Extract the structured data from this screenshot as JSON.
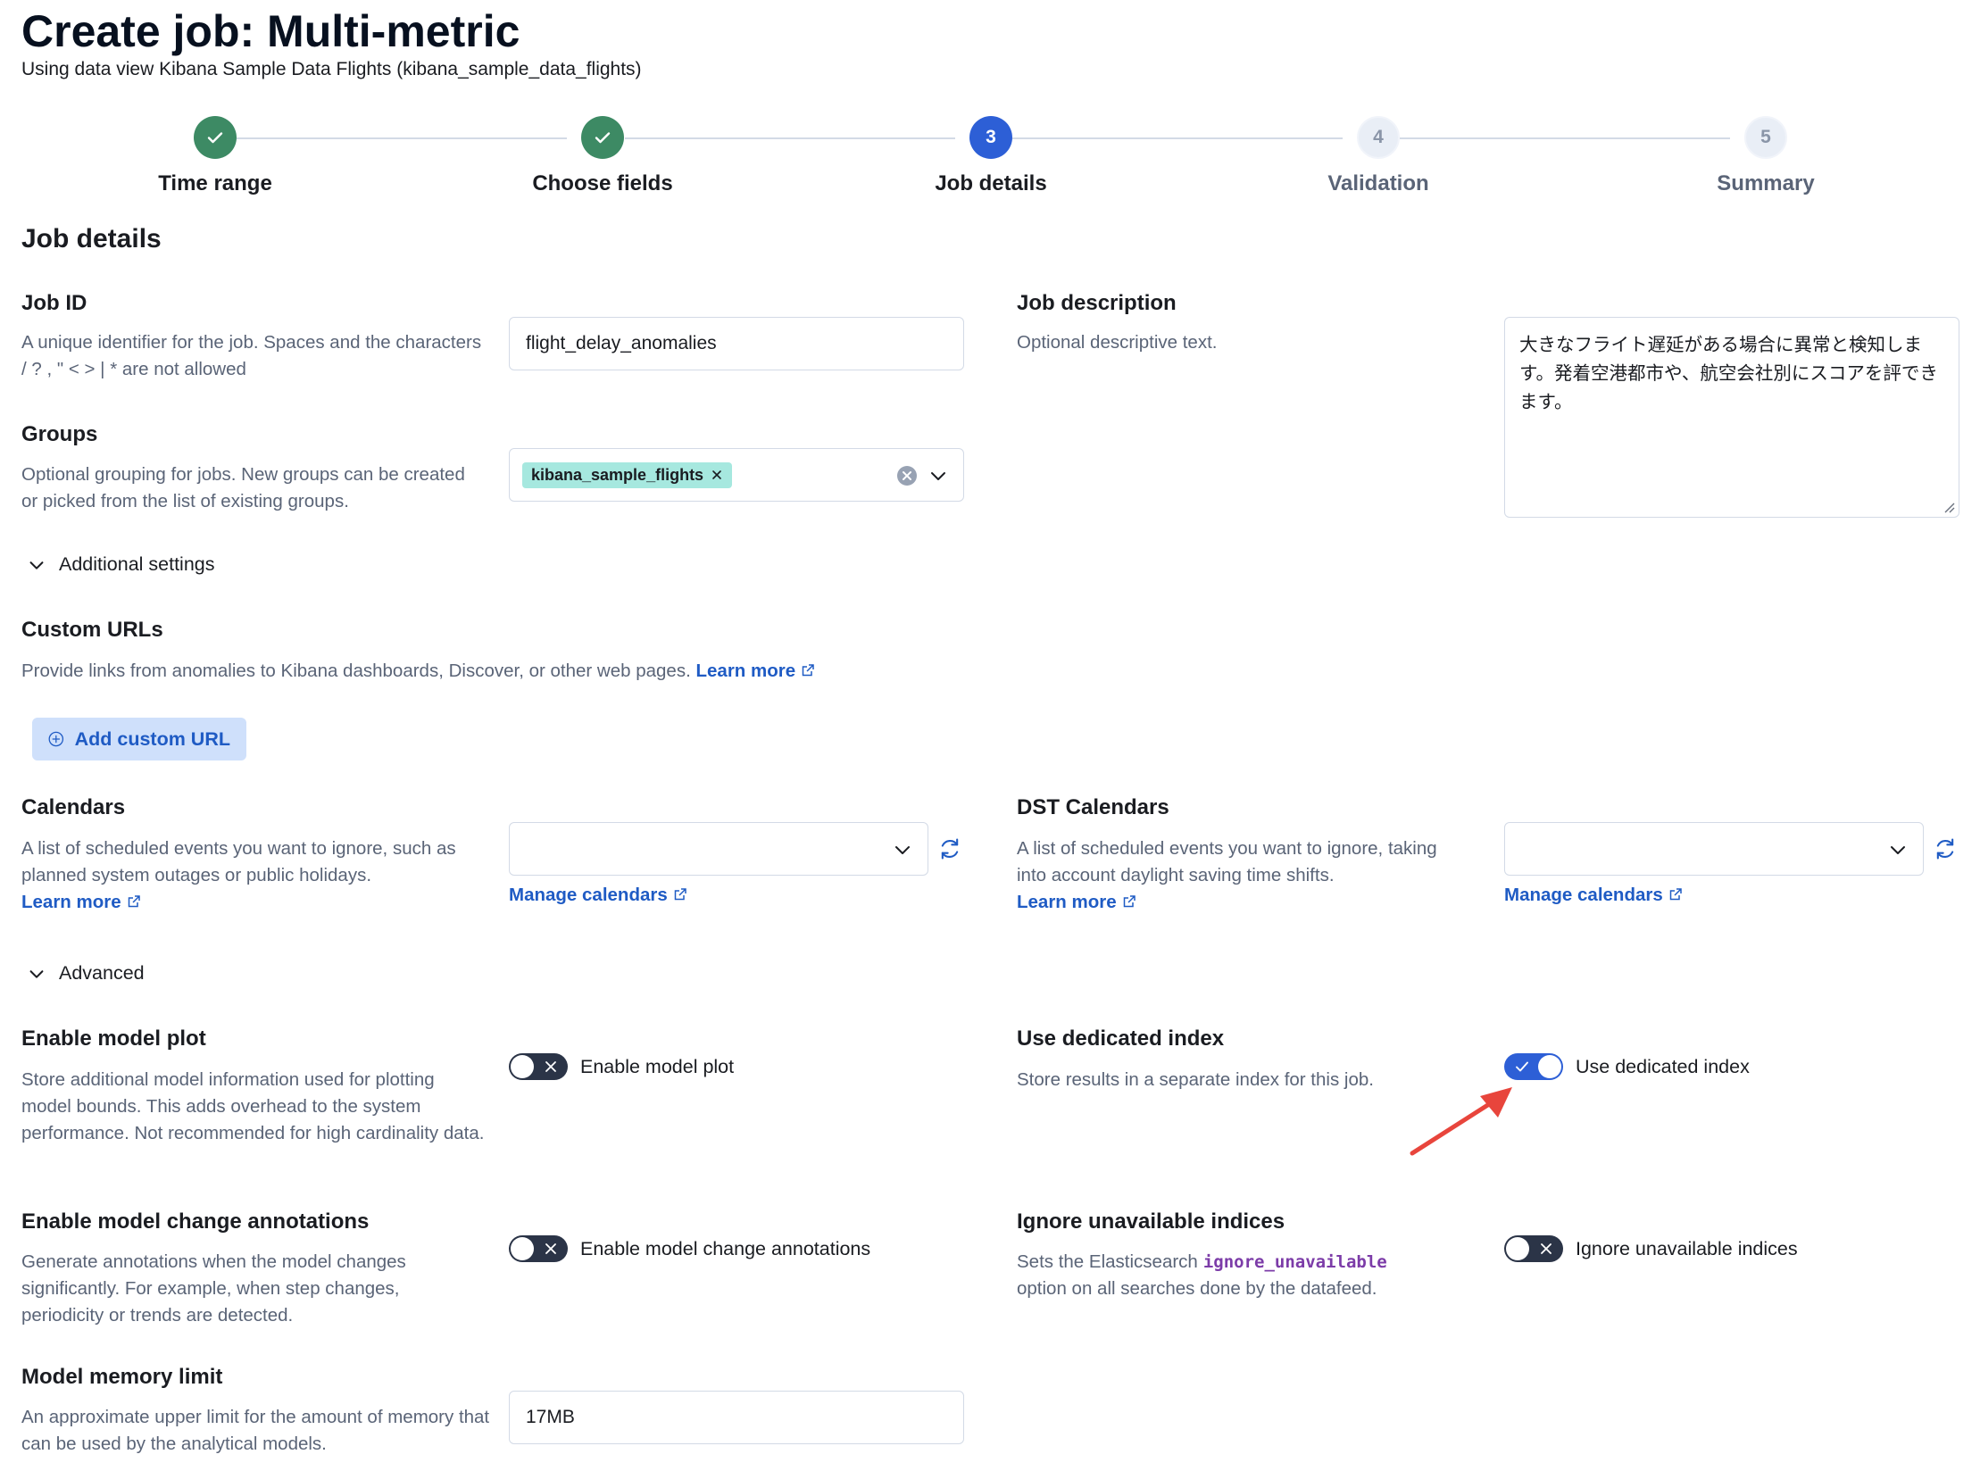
{
  "header": {
    "title": "Create job: Multi-metric",
    "subtitle": "Using data view Kibana Sample Data Flights (kibana_sample_data_flights)"
  },
  "steps": [
    {
      "label": "Time range",
      "number": "1",
      "status": "complete"
    },
    {
      "label": "Choose fields",
      "number": "2",
      "status": "complete"
    },
    {
      "label": "Job details",
      "number": "3",
      "status": "current"
    },
    {
      "label": "Validation",
      "number": "4",
      "status": "incomplete"
    },
    {
      "label": "Summary",
      "number": "5",
      "status": "incomplete"
    }
  ],
  "section_title": "Job details",
  "job_id": {
    "title": "Job ID",
    "help": "A unique identifier for the job. Spaces and the characters / ? , \" < > | * are not allowed",
    "value": "flight_delay_anomalies"
  },
  "job_description": {
    "title": "Job description",
    "help": "Optional descriptive text.",
    "value": "大きなフライト遅延がある場合に異常と検知します。発着空港都市や、航空会社別にスコアを評できます。"
  },
  "groups": {
    "title": "Groups",
    "help": "Optional grouping for jobs. New groups can be created or picked from the list of existing groups.",
    "selected": "kibana_sample_flights"
  },
  "additional_settings": {
    "label": "Additional settings"
  },
  "custom_urls": {
    "title": "Custom URLs",
    "help": "Provide links from anomalies to Kibana dashboards, Discover, or other web pages.",
    "learn_more": "Learn more",
    "add_button": "Add custom URL"
  },
  "calendars": {
    "title": "Calendars",
    "help": "A list of scheduled events you want to ignore, such as planned system outages or public holidays.",
    "learn_more": "Learn more",
    "manage": "Manage calendars"
  },
  "dst_calendars": {
    "title": "DST Calendars",
    "help": "A list of scheduled events you want to ignore, taking into account daylight saving time shifts.",
    "learn_more": "Learn more",
    "manage": "Manage calendars"
  },
  "advanced": {
    "label": "Advanced"
  },
  "model_plot": {
    "title": "Enable model plot",
    "help": "Store additional model information used for plotting model bounds. This adds overhead to the system performance. Not recommended for high cardinality data.",
    "toggle_label": "Enable model plot",
    "enabled": false
  },
  "dedicated_index": {
    "title": "Use dedicated index",
    "help": "Store results in a separate index for this job.",
    "toggle_label": "Use dedicated index",
    "enabled": true
  },
  "model_change_annotations": {
    "title": "Enable model change annotations",
    "help": "Generate annotations when the model changes significantly. For example, when step changes, periodicity or trends are detected.",
    "toggle_label": "Enable model change annotations",
    "enabled": false
  },
  "ignore_unavailable": {
    "title": "Ignore unavailable indices",
    "help_prefix": "Sets the Elasticsearch",
    "help_code": "ignore_unavailable",
    "help_suffix": "option on all searches done by the datafeed.",
    "toggle_label": "Ignore unavailable indices",
    "enabled": false
  },
  "memory_limit": {
    "title": "Model memory limit",
    "help": "An approximate upper limit for the amount of memory that can be used by the analytical models.",
    "value": "17MB"
  },
  "colors": {
    "complete": "#3d8a64",
    "current": "#2d5fd6",
    "link": "#1f5bc4",
    "chip": "#a6e8df",
    "annotation_arrow": "#e8453c"
  },
  "icons": {
    "check": "check-icon",
    "external": "external-link-icon",
    "clear": "clear-icon",
    "chevron": "chevron-down-icon",
    "refresh": "refresh-icon",
    "plus": "plus-circle-icon",
    "cross": "cross-icon"
  }
}
